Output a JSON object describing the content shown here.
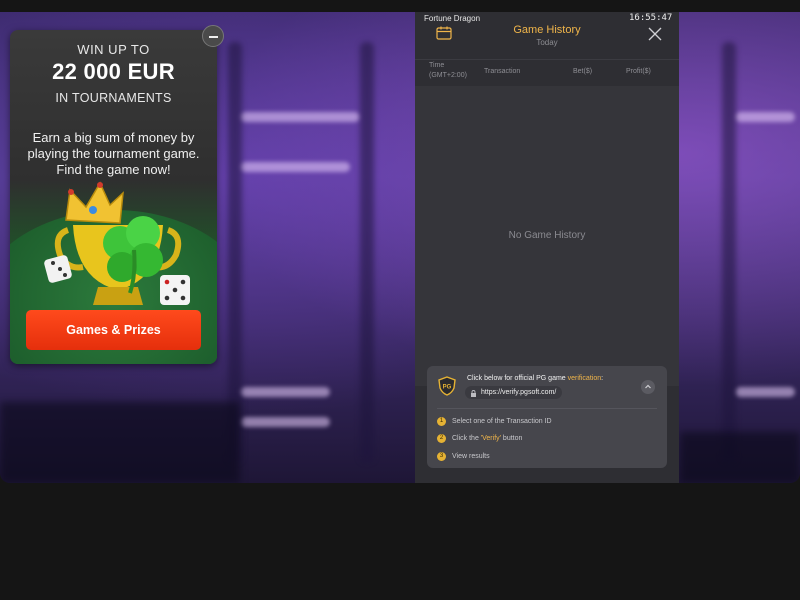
{
  "promo": {
    "headline_top": "WIN UP TO",
    "amount": "22 000 EUR",
    "headline_sub": "IN TOURNAMENTS",
    "description": "Earn a big sum of money by playing the tournament game. Find the game now!",
    "button_label": "Games & Prizes",
    "accent": "#ff3d12"
  },
  "history": {
    "game_name": "Fortune Dragon",
    "clock": "16:55:47",
    "title": "Game History",
    "period": "Today",
    "columns": {
      "time": "Time",
      "timezone": "(GMT+2:00)",
      "transaction": "Transaction",
      "bet": "Bet($)",
      "profit": "Profit($)"
    },
    "empty_text": "No Game History",
    "verify": {
      "intro_prefix": "Click below for official PG game ",
      "intro_highlight": "verification",
      "intro_suffix": ":",
      "url": "https://verify.pgsoft.com/",
      "steps": [
        {
          "num": "1",
          "text": "Select one of the Transaction ID"
        },
        {
          "num": "2",
          "text_before": "Click the ",
          "highlight": "'Verify'",
          "text_after": " button"
        },
        {
          "num": "3",
          "text": "View results"
        }
      ]
    },
    "title_color": "#f0b54a"
  }
}
